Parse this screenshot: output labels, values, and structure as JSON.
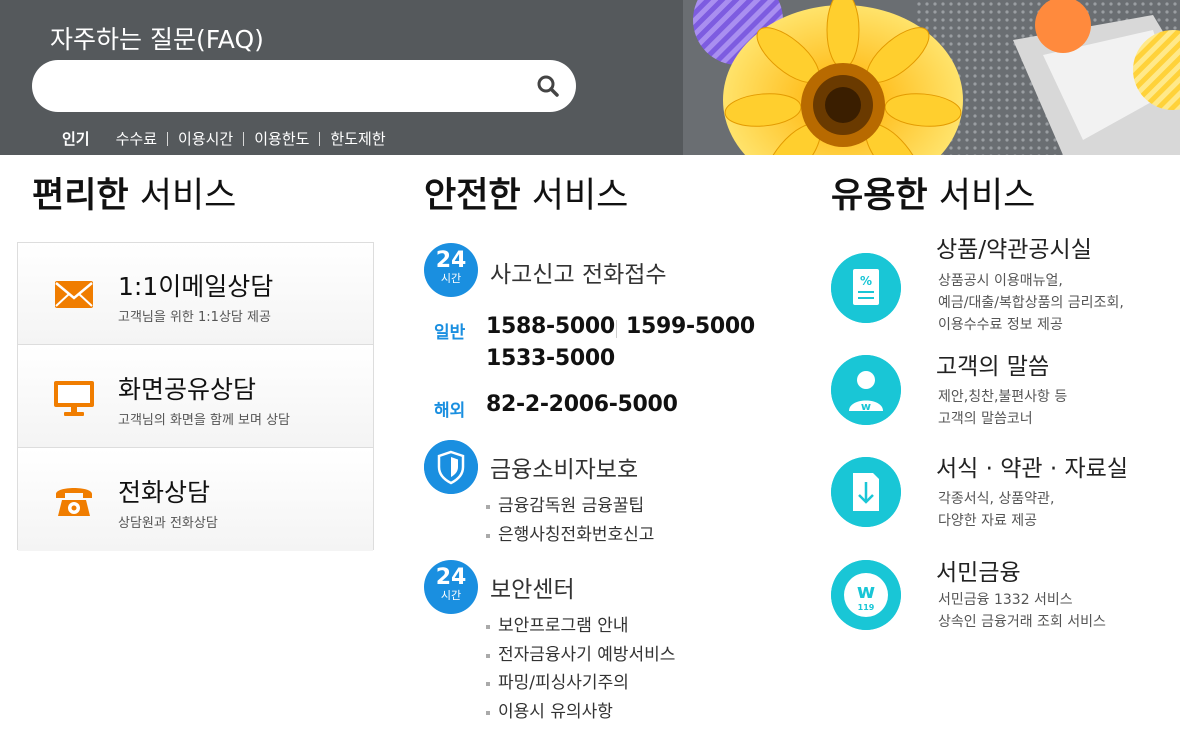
{
  "header": {
    "title": "자주하는 질문(FAQ)",
    "search_placeholder": "",
    "popular_label": "인기",
    "keywords": [
      "수수료",
      "이용시간",
      "이용한도",
      "한도제한"
    ]
  },
  "sections": {
    "convenient": {
      "bold": "편리한",
      "light": "서비스"
    },
    "safe": {
      "bold": "안전한",
      "light": "서비스"
    },
    "useful": {
      "bold": "유용한",
      "light": "서비스"
    }
  },
  "consult": [
    {
      "title": "1:1이메일상담",
      "sub": "고객님을 위한 1:1상담 제공",
      "icon": "envelope-icon"
    },
    {
      "title": "화면공유상담",
      "sub": "고객님의 화면을 함께 보며 상담",
      "icon": "monitor-icon"
    },
    {
      "title": "전화상담",
      "sub": "상담원과 전화상담",
      "icon": "telephone-icon"
    }
  ],
  "safe": {
    "accident": {
      "badge_num": "24",
      "badge_text": "시간",
      "title": "사고신고 전화접수",
      "general_label": "일반",
      "general_numbers": [
        "1588-5000",
        "1599-5000",
        "1533-5000"
      ],
      "overseas_label": "해외",
      "overseas_number": "82-2-2006-5000"
    },
    "consumer": {
      "title": "금융소비자보호",
      "items": [
        "금융감독원 금융꿀팁",
        "은행사칭전화번호신고"
      ]
    },
    "security": {
      "badge_num": "24",
      "badge_text": "시간",
      "title": "보안센터",
      "items": [
        "보안프로그램 안내",
        "전자금융사기 예방서비스",
        "파밍/피싱사기주의",
        "이용시 유의사항"
      ]
    }
  },
  "useful": [
    {
      "title": "상품/약관공시실",
      "desc": [
        "상품공시 이용매뉴얼,",
        "예금/대출/복합상품의 금리조회,",
        "이용수수료 정보 제공"
      ],
      "icon": "percent-document-icon"
    },
    {
      "title": "고객의 말씀",
      "desc": [
        "제안,칭찬,불편사항 등",
        "고객의 말씀코너"
      ],
      "icon": "customer-person-icon"
    },
    {
      "title": "서식 · 약관 · 자료실",
      "desc": [
        "각종서식, 상품약관,",
        "다양한 자료 제공"
      ],
      "icon": "download-document-icon"
    },
    {
      "title": "서민금융",
      "desc": [
        "서민금융 1332 서비스",
        "상속인 금융거래 조회 서비스"
      ],
      "icon": "w-119-icon",
      "badge": "119"
    }
  ],
  "colors": {
    "header_bg": "#55595c",
    "accent_blue": "#1a8fe0",
    "accent_cyan": "#19c6d6",
    "accent_orange": "#f07d00"
  }
}
